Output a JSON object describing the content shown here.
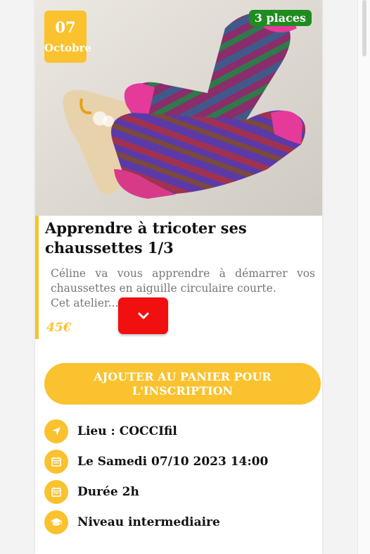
{
  "event": {
    "date_day": "07",
    "date_month": "Octobre",
    "places": "3 places",
    "title": "Apprendre à tricoter ses chaussettes 1/3",
    "description_line1": "Céline va vous apprendre à démarrer vos chaussettes en aiguille circulaire courte.",
    "description_line2": "Cet atelier...",
    "price": "45€"
  },
  "actions": {
    "add_to_cart": "AJOUTER AU PANIER POUR L'INSCRIPTION"
  },
  "details": {
    "location": "Lieu : COCCIfil",
    "datetime": "Le Samedi 07/10 2023 14:00",
    "duration": "Durée 2h",
    "level": "Niveau intermediaire"
  },
  "icons": {
    "expand": "chevron-down-icon",
    "location": "location-arrow-icon",
    "datetime": "calendar-icon",
    "duration": "calendar-icon",
    "level": "graduation-cap-icon"
  },
  "colors": {
    "accent": "#f9c22e",
    "places_badge": "#1e8c1e",
    "expand_button": "#f20f0f"
  }
}
